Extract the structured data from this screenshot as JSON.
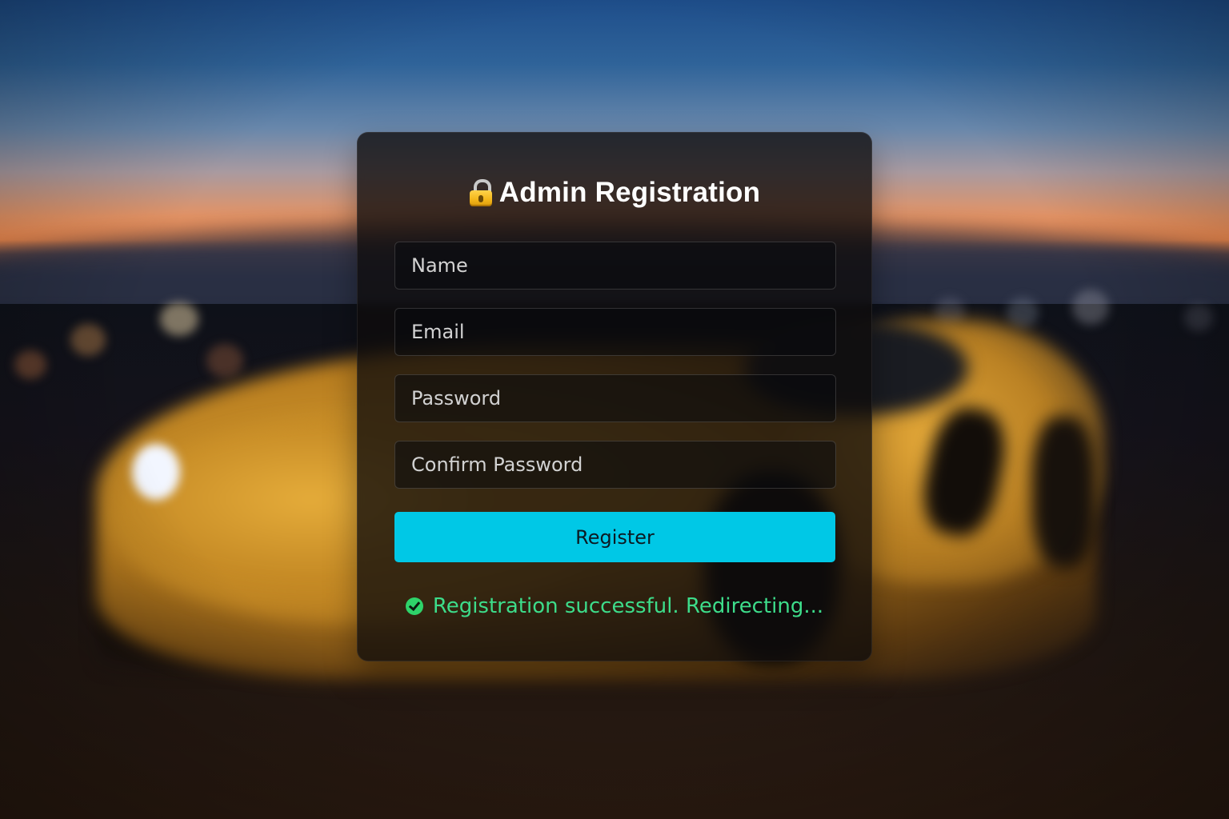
{
  "form": {
    "title": "Admin Registration",
    "title_icon": "lock-icon",
    "fields": {
      "name_placeholder": "Name",
      "email_placeholder": "Email",
      "password_placeholder": "Password",
      "confirm_password_placeholder": "Confirm Password"
    },
    "submit_label": "Register",
    "status": {
      "icon": "check-circle-icon",
      "message": "Registration successful. Redirecting..."
    }
  },
  "colors": {
    "accent": "#00c8e6",
    "success": "#3ddc8a",
    "lock": "#f3b519"
  }
}
